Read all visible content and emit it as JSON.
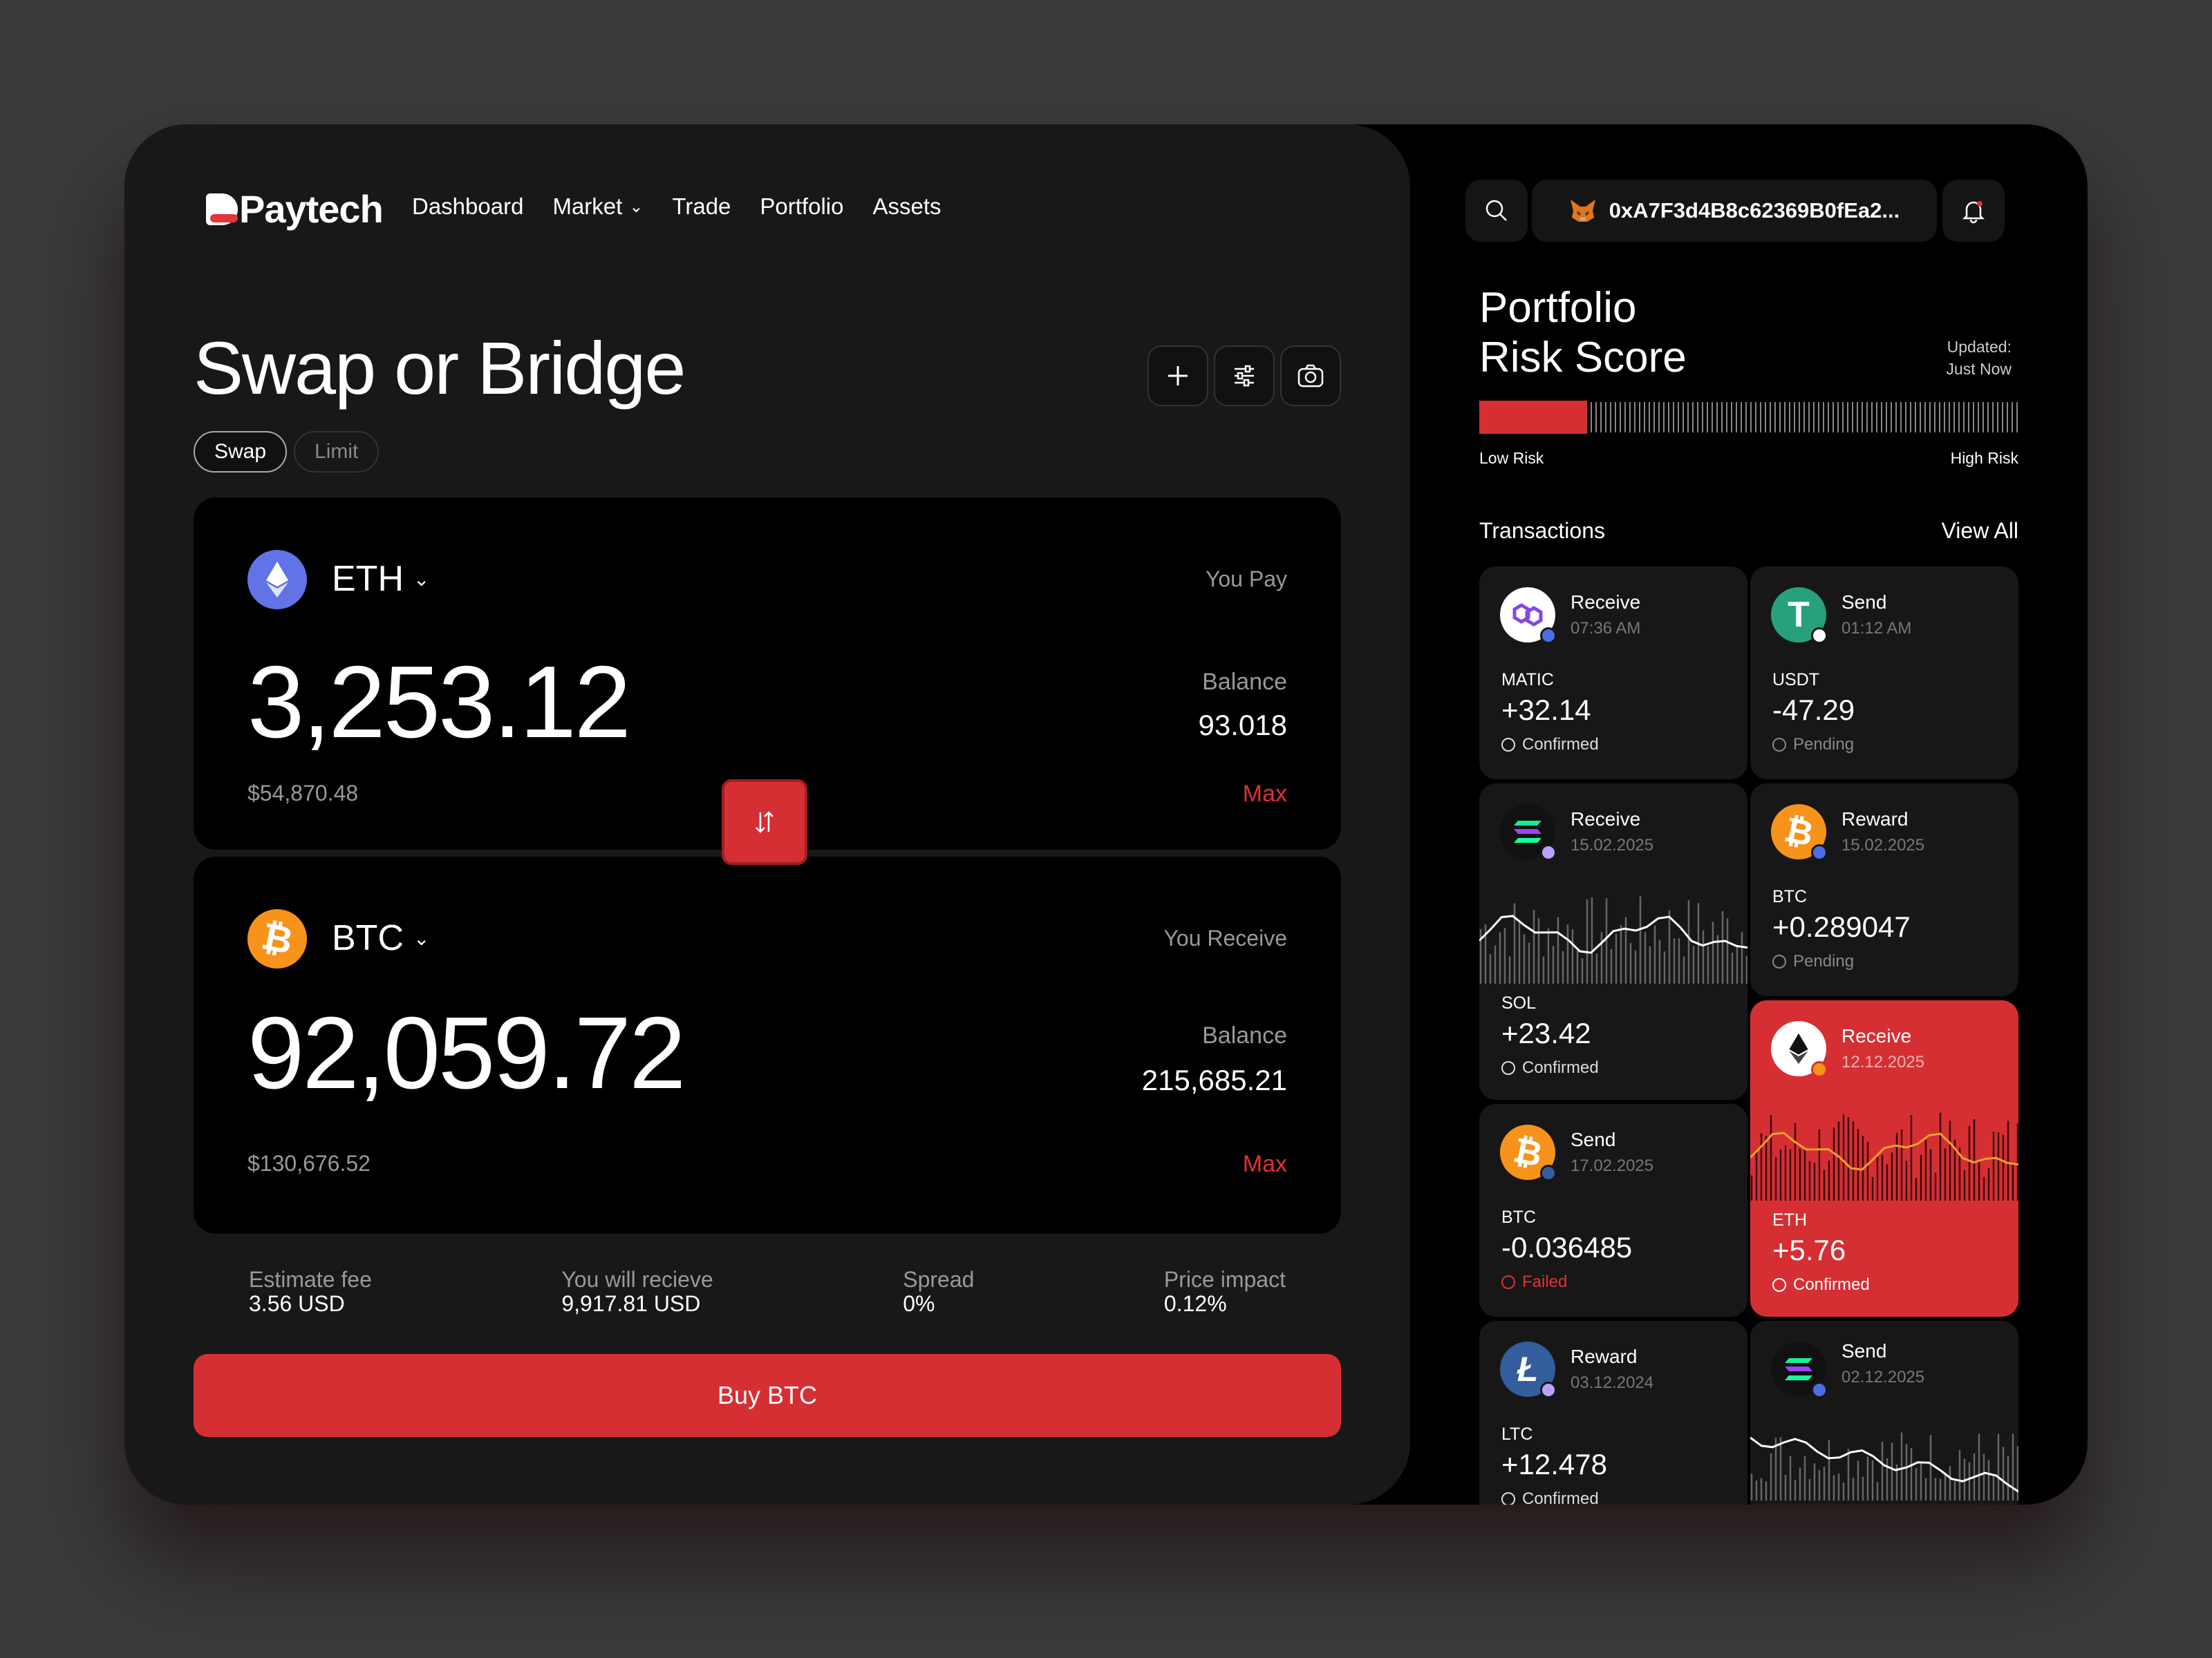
{
  "brand": {
    "name": "Paytech"
  },
  "nav": {
    "items": [
      "Dashboard",
      "Market",
      "Trade",
      "Portfolio",
      "Assets"
    ]
  },
  "swap": {
    "title": "Swap or Bridge",
    "tabs": [
      "Swap",
      "Limit"
    ],
    "pay": {
      "symbol": "ETH",
      "label": "You Pay",
      "amount": "3,253.12",
      "usd": "$54,870.48",
      "balance_label": "Balance",
      "balance": "93.018",
      "max": "Max"
    },
    "receive": {
      "symbol": "BTC",
      "label": "You Receive",
      "amount": "92,059.72",
      "usd": "$130,676.52",
      "balance_label": "Balance",
      "balance": "215,685.21",
      "max": "Max"
    },
    "stats": [
      {
        "k": "Estimate fee",
        "v": "3.56 USD"
      },
      {
        "k": "You will recieve",
        "v": "9,917.81 USD"
      },
      {
        "k": "Spread",
        "v": "0%"
      },
      {
        "k": "Price impact",
        "v": "0.12%"
      }
    ],
    "buy_label": "Buy BTC"
  },
  "header": {
    "wallet": "0xA7F3d4B8c62369B0fEa2..."
  },
  "risk": {
    "title1": "Portfolio",
    "title2": "Risk Score",
    "updated1": "Updated:",
    "updated2": "Just Now",
    "low": "Low Risk",
    "high": "High Risk",
    "level": 0.2,
    "accent": "#d62f33"
  },
  "transactions": {
    "title": "Transactions",
    "view_all": "View All",
    "items": [
      {
        "type": "Receive",
        "time": "07:36 AM",
        "asset": "MATIC",
        "amount": "+32.14",
        "status": "Confirmed"
      },
      {
        "type": "Send",
        "time": "01:12 AM",
        "asset": "USDT",
        "amount": "-47.29",
        "status": "Pending"
      },
      {
        "type": "Receive",
        "time": "15.02.2025",
        "asset": "SOL",
        "amount": "+23.42",
        "status": "Confirmed"
      },
      {
        "type": "Reward",
        "time": "15.02.2025",
        "asset": "BTC",
        "amount": "+0.289047",
        "status": "Pending"
      },
      {
        "type": "Receive",
        "time": "12.12.2025",
        "asset": "ETH",
        "amount": "+5.76",
        "status": "Confirmed"
      },
      {
        "type": "Send",
        "time": "17.02.2025",
        "asset": "BTC",
        "amount": "-0.036485",
        "status": "Failed"
      },
      {
        "type": "Reward",
        "time": "03.12.2024",
        "asset": "LTC",
        "amount": "+12.478",
        "status": "Confirmed"
      },
      {
        "type": "Send",
        "time": "02.12.2025",
        "asset": "",
        "amount": "",
        "status": ""
      }
    ]
  }
}
